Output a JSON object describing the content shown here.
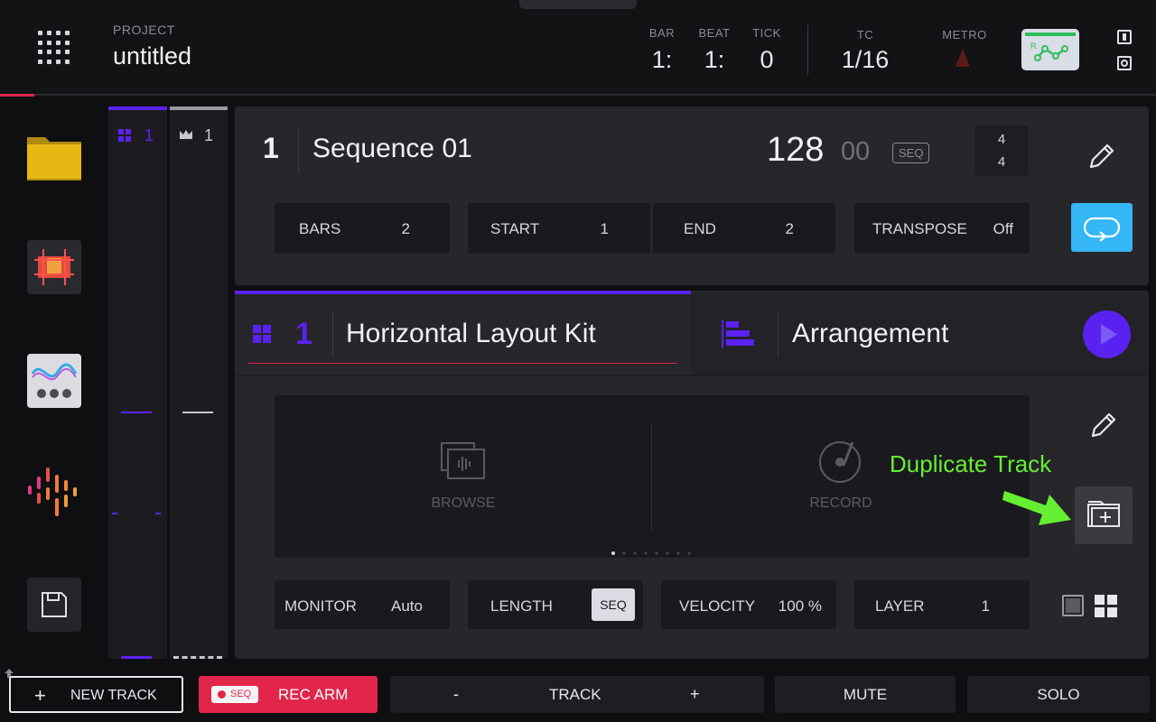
{
  "header": {
    "project_label": "PROJECT",
    "project_name": "untitled",
    "bar_label": "BAR",
    "bar_value": "1:",
    "beat_label": "BEAT",
    "beat_value": "1:",
    "tick_label": "TICK",
    "tick_value": "0",
    "tc_label": "TC",
    "tc_value": "1/16",
    "metro_label": "METRO",
    "automation_letter": "R"
  },
  "strips": {
    "left_number": "1",
    "right_number": "1"
  },
  "sequence": {
    "number": "1",
    "name": "Sequence 01",
    "bpm": "128",
    "bpm_decimal": "00",
    "seq_badge": "SEQ",
    "time_sig_top": "4",
    "time_sig_bottom": "4",
    "fields": [
      {
        "label": "BARS",
        "value": "2"
      },
      {
        "label": "START",
        "value": "1"
      },
      {
        "label": "END",
        "value": "2"
      },
      {
        "label": "TRANSPOSE",
        "value": "Off"
      }
    ]
  },
  "track": {
    "number": "1",
    "name": "Horizontal Layout Kit",
    "arrangement_label": "Arrangement",
    "browse_label": "BROWSE",
    "record_label": "RECORD",
    "fields": [
      {
        "label": "MONITOR",
        "value": "Auto"
      },
      {
        "label": "LENGTH",
        "value": "SEQ"
      },
      {
        "label": "VELOCITY",
        "value": "100 %"
      },
      {
        "label": "LAYER",
        "value": "1"
      }
    ]
  },
  "annotation": {
    "label": "Duplicate Track"
  },
  "bottom": {
    "new_track": "NEW TRACK",
    "seq_badge": "SEQ",
    "rec_arm": "REC ARM",
    "track_minus": "-",
    "track_label": "TRACK",
    "track_plus": "+",
    "mute": "MUTE",
    "solo": "SOLO"
  },
  "colors": {
    "accent_purple": "#5a22f0",
    "rec_red": "#e1264a",
    "loop_blue": "#35b6f5",
    "annotation_green": "#66ee33"
  }
}
